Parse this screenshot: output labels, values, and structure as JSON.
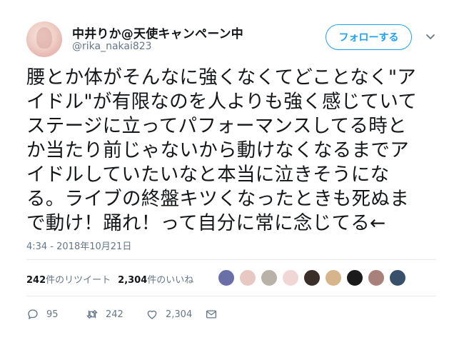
{
  "user": {
    "display_name": "中井りか@天使キャンペーン中",
    "handle": "@rika_nakai823"
  },
  "follow_button": {
    "label": "フォローする"
  },
  "tweet": {
    "lines": [
      "腰とか体がそんなに強くなくてどことなく\"ア",
      "イドル\"が有限なのを人よりも強く感じていて",
      "ステージに立ってパフォーマンスしてる時と",
      "か当たり前じゃないから動けなくなるまでア",
      "イドルしていたいなと本当に泣きそうにな",
      "る。ライブの終盤キツくなったときも死ぬま",
      "で動け！踊れ！って自分に常に念じてる←"
    ],
    "timestamp": "4:34 - 2018年10月21日"
  },
  "stats": {
    "retweets_count": "242",
    "retweets_label": "件のリツイート",
    "likes_count": "2,304",
    "likes_label": "件のいいね"
  },
  "liker_avatars": [
    "#6b6fa8",
    "#e8c8c2",
    "#b9b2a8",
    "#f1d6d6",
    "#3b2f2a",
    "#d6b58c",
    "#1b1b1b",
    "#a9807a",
    "#39506b"
  ],
  "actions": {
    "reply_count": "95",
    "retweet_count": "242",
    "like_count": "2,304"
  },
  "colors": {
    "accent": "#1da1f2",
    "secondary_text": "#657786",
    "divider": "#e6ecf0"
  }
}
